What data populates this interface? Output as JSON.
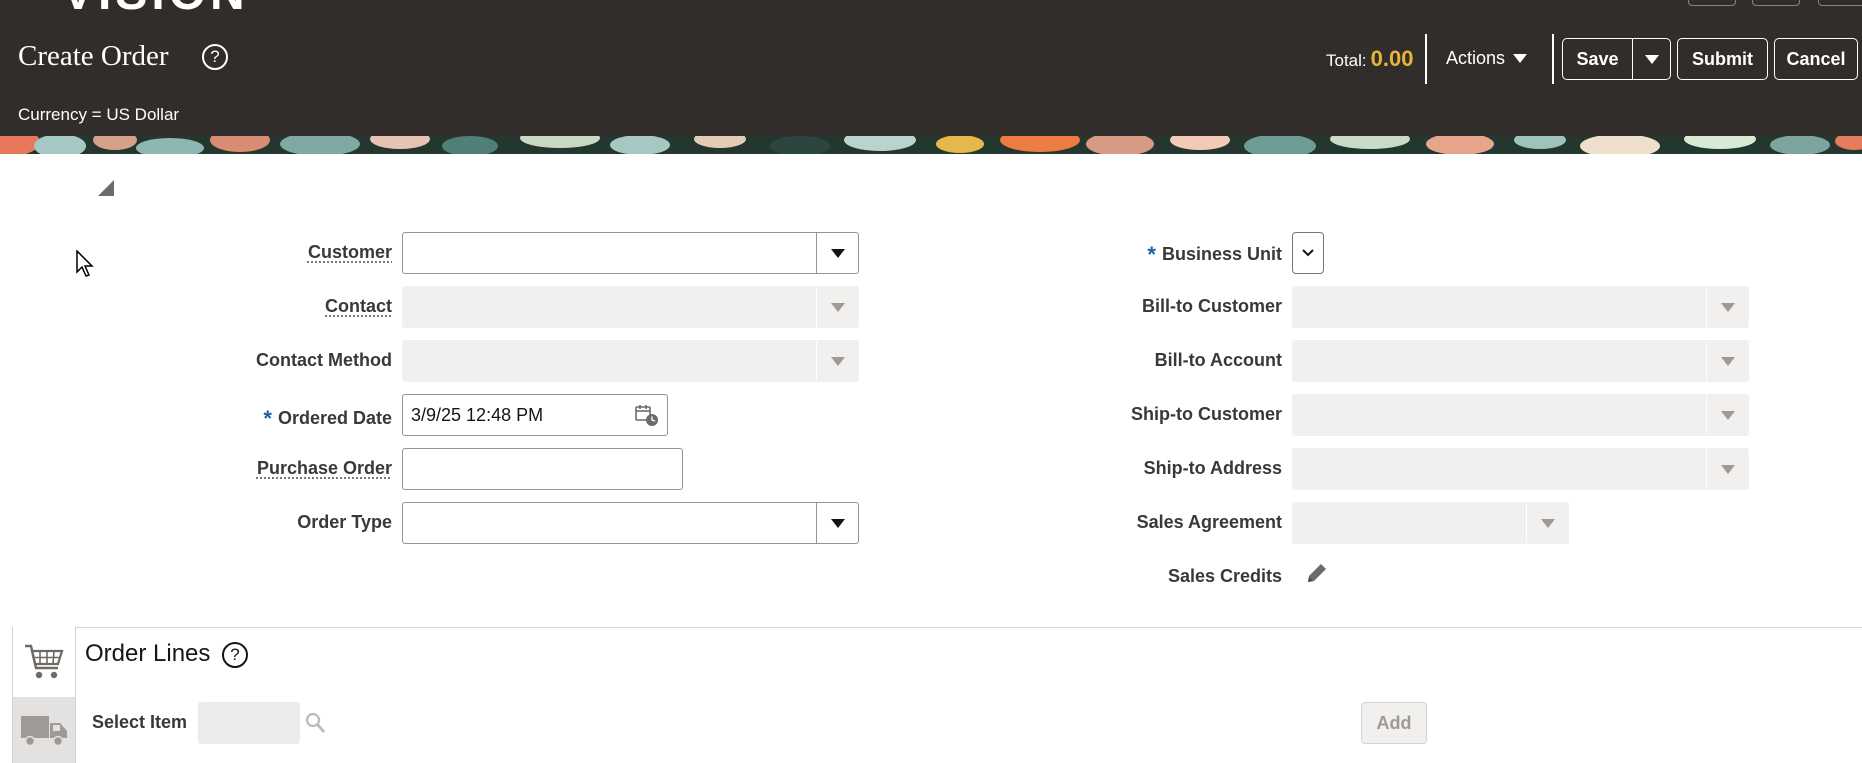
{
  "header": {
    "brand": "VISION",
    "title": "Create Order",
    "currency": "Currency = US Dollar",
    "total_label": "Total:",
    "total_value": "0.00",
    "actions_label": "Actions",
    "save_label": "Save",
    "submit_label": "Submit",
    "cancel_label": "Cancel",
    "help_glyph": "?"
  },
  "form": {
    "left": {
      "customer": {
        "label": "Customer",
        "value": ""
      },
      "contact": {
        "label": "Contact",
        "value": ""
      },
      "contact_method": {
        "label": "Contact Method",
        "value": ""
      },
      "ordered_date": {
        "label": "Ordered Date",
        "value": "3/9/25 12:48 PM"
      },
      "purchase_order": {
        "label": "Purchase Order",
        "value": ""
      },
      "order_type": {
        "label": "Order Type",
        "value": ""
      }
    },
    "right": {
      "business_unit": {
        "label": "Business Unit",
        "value": ""
      },
      "bill_to_customer": {
        "label": "Bill-to Customer",
        "value": ""
      },
      "bill_to_account": {
        "label": "Bill-to Account",
        "value": ""
      },
      "ship_to_customer": {
        "label": "Ship-to Customer",
        "value": ""
      },
      "ship_to_address": {
        "label": "Ship-to Address",
        "value": ""
      },
      "sales_agreement": {
        "label": "Sales Agreement",
        "value": ""
      },
      "sales_credits": {
        "label": "Sales Credits"
      }
    },
    "required_mark": "*"
  },
  "order_lines": {
    "title": "Order Lines",
    "select_item_label": "Select Item",
    "select_item_value": "",
    "add_label": "Add"
  },
  "colors": {
    "header_bg": "#312d2a",
    "total_accent": "#e8b33c",
    "required_blue": "#1f5fa8"
  },
  "icons": [
    "help-icon",
    "dropdown-arrow-icon",
    "calendar-clock-icon",
    "chevron-down-icon",
    "pencil-icon",
    "cart-icon",
    "truck-icon",
    "search-icon",
    "cursor-arrow-icon"
  ]
}
